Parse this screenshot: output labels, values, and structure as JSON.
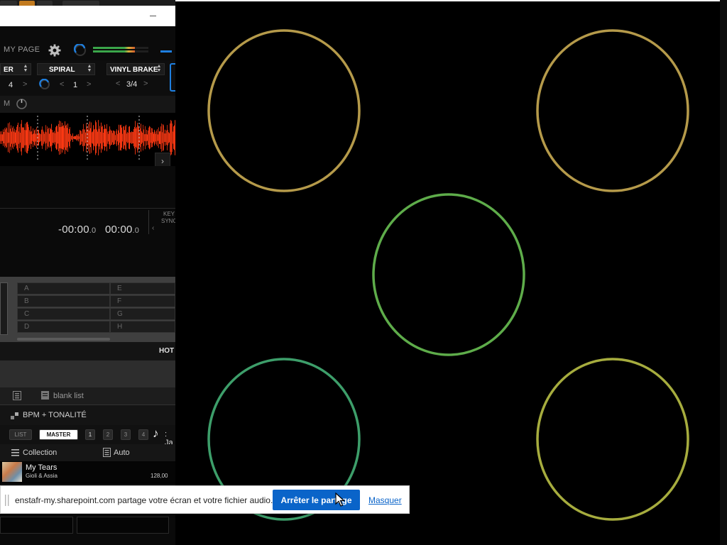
{
  "dj_app": {
    "toolbar": {
      "mypage_label": "MY PAGE"
    },
    "fx_row": {
      "slot1_label": "ER",
      "slot2_label": "SPIRAL",
      "slot3_label": "VINYL BRAKE",
      "slot1_value": "4",
      "slot2_value": "1",
      "slot3_value": "3/4"
    },
    "deck": {
      "m_label": "M",
      "time_remaining_main": "-00:00",
      "time_remaining_frac": ".0",
      "time_elapsed_main": "00:00",
      "time_elapsed_frac": ".0",
      "key_label": "KEY",
      "sync_label": "SYNC",
      "waveform_color": "#ff3a14"
    },
    "hotcues": {
      "left_col": [
        "A",
        "B",
        "C",
        "D"
      ],
      "right_col": [
        "E",
        "F",
        "G",
        "H"
      ],
      "hot_label": "HOT"
    },
    "browser": {
      "playlist_label": "blank list",
      "bpm_header": "BPM + TONALITÉ",
      "filters": {
        "list": "LIST",
        "master": "MASTER",
        "n1": "1",
        "n2": "2",
        "n3": "3",
        "n4": "4",
        "trailing": ": Ja"
      },
      "collection_label": "Collection",
      "auto_label": "Auto",
      "track": {
        "title": "My Tears",
        "artist": "Gioli & Assia",
        "bpm": "128,00"
      }
    },
    "bottom": {
      "left_time": "",
      "right_time": ""
    }
  },
  "visualizer": {
    "rings": [
      {
        "name": "top-left",
        "color": "#b59a4a"
      },
      {
        "name": "top-right",
        "color": "#b59a4a"
      },
      {
        "name": "center",
        "color": "#5eac4a"
      },
      {
        "name": "bottom-left",
        "color": "#3d9e6a"
      },
      {
        "name": "bottom-right",
        "color": "#a6ac3e"
      }
    ]
  },
  "share_bar": {
    "message": "enstafr-my.sharepoint.com partage votre écran et votre fichier audio.",
    "stop_button": "Arrêter le partage",
    "hide_link": "Masquer"
  }
}
